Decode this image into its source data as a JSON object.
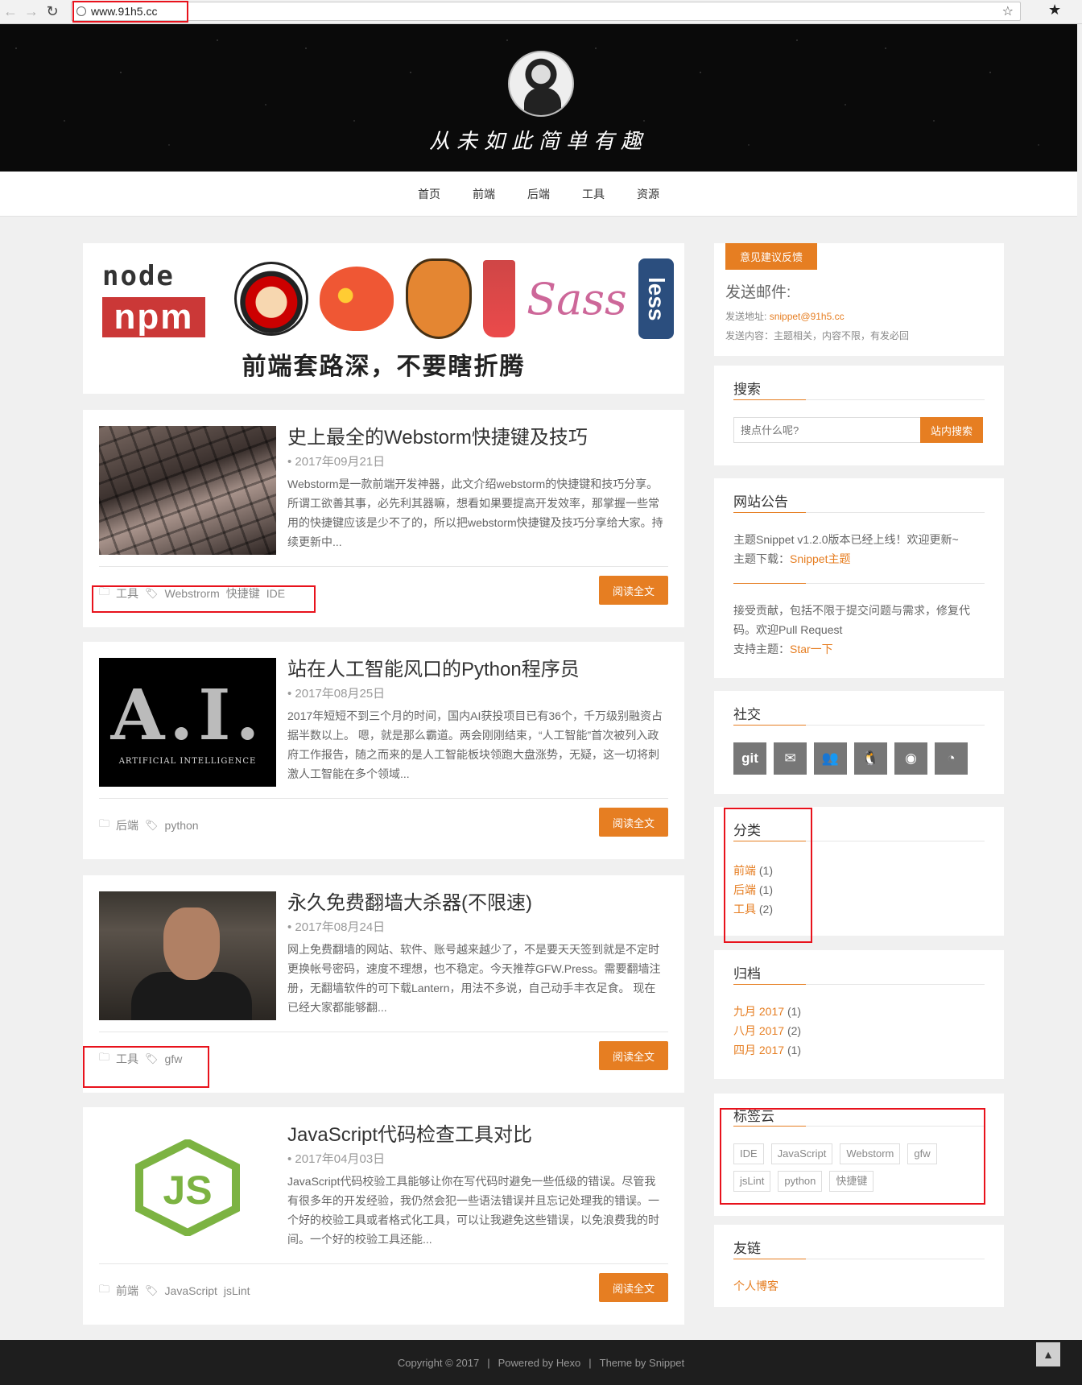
{
  "browser": {
    "url": "www.91h5.cc",
    "back_icon": "←",
    "forward_icon": "→",
    "reload_icon": "↻",
    "star_icon": "☆",
    "ext_icon": "★"
  },
  "header": {
    "tagline": "从未如此简单有趣"
  },
  "nav": [
    "首页",
    "前端",
    "后端",
    "工具",
    "资源"
  ],
  "banner": {
    "node_text": "node",
    "npm_text": "npm",
    "sass_text": "Sass",
    "less_text": "less",
    "gulp_text": "Gulp",
    "slogan": "前端套路深，不要瞎折腾"
  },
  "posts": [
    {
      "title": "史上最全的Webstorm快捷键及技巧",
      "date": "• 2017年09月21日",
      "excerpt": "Webstorm是一款前端开发神器，此文介绍webstorm的快捷键和技巧分享。 所谓工欲善其事，必先利其器嘛，想看如果要提高开发效率，那掌握一些常用的快捷键应该是少不了的，所以把webstorm快捷键及技巧分享给大家。持续更新中...",
      "category": "工具",
      "tags": [
        "Webstrorm",
        "快捷键",
        "IDE"
      ],
      "read_label": "阅读全文"
    },
    {
      "title": "站在人工智能风口的Python程序员",
      "date": "• 2017年08月25日",
      "excerpt": "2017年短短不到三个月的时间，国内AI获投项目已有36个，千万级别融资占据半数以上。 嗯，就是那么霸道。两会刚刚结束，“人工智能”首次被列入政府工作报告，随之而来的是人工智能板块领跑大盘涨势，无疑，这一切将刺激人工智能在多个领域...",
      "category": "后端",
      "tags": [
        "python"
      ],
      "read_label": "阅读全文",
      "thumb_big": "A.I.",
      "thumb_small": "ARTIFICIAL INTELLIGENCE"
    },
    {
      "title": "永久免费翻墙大杀器(不限速)",
      "date": "• 2017年08月24日",
      "excerpt": "网上免费翻墙的网站、软件、账号越来越少了，不是要天天签到就是不定时更换帐号密码，速度不理想，也不稳定。今天推荐GFW.Press。需要翻墙注册，无翻墙软件的可下载Lantern，用法不多说，自己动手丰衣足食。 现在已经大家都能够翻...",
      "category": "工具",
      "tags": [
        "gfw"
      ],
      "read_label": "阅读全文"
    },
    {
      "title": "JavaScript代码检查工具对比",
      "date": "• 2017年04月03日",
      "excerpt": "JavaScript代码校验工具能够让你在写代码时避免一些低级的错误。尽管我有很多年的开发经验，我仍然会犯一些语法错误并且忘记处理我的错误。一个好的校验工具或者格式化工具，可以让我避免这些错误，以免浪费我的时间。一个好的校验工具还能...",
      "category": "前端",
      "tags": [
        "JavaScript",
        "jsLint"
      ],
      "read_label": "阅读全文"
    }
  ],
  "sidebar": {
    "feedback": {
      "tag": "意见建议反馈",
      "heading": "发送邮件:",
      "address_label": "发送地址:",
      "address": "snippet@91h5.cc",
      "content_line": "发送内容：主题相关，内容不限，有发必回"
    },
    "search": {
      "title": "搜索",
      "placeholder": "搜点什么呢?",
      "button": "站内搜索"
    },
    "notice": {
      "title": "网站公告",
      "line1": "主题Snippet v1.2.0版本已经上线！欢迎更新~",
      "line2_label": "主题下载：",
      "line2_link": "Snippet主题",
      "line3": "接受贡献，包括不限于提交问题与需求，修复代",
      "line4": "码。欢迎Pull Request",
      "line5_label": "支持主题：",
      "line5_link": "Star一下"
    },
    "social": {
      "title": "社交",
      "icons": [
        {
          "name": "git-icon",
          "glyph": "git"
        },
        {
          "name": "mail-icon",
          "glyph": "✉"
        },
        {
          "name": "group-icon",
          "glyph": "👥"
        },
        {
          "name": "qq-icon",
          "glyph": "🐧"
        },
        {
          "name": "weibo-icon",
          "glyph": "◉"
        },
        {
          "name": "rss-icon",
          "glyph": "◔"
        }
      ]
    },
    "categories": {
      "title": "分类",
      "items": [
        {
          "label": "前端",
          "count": "(1)"
        },
        {
          "label": "后端",
          "count": "(1)"
        },
        {
          "label": "工具",
          "count": "(2)"
        }
      ]
    },
    "archive": {
      "title": "归档",
      "items": [
        {
          "label": "九月 2017",
          "count": "(1)"
        },
        {
          "label": "八月 2017",
          "count": "(2)"
        },
        {
          "label": "四月 2017",
          "count": "(1)"
        }
      ]
    },
    "tagcloud": {
      "title": "标签云",
      "tags": [
        "IDE",
        "JavaScript",
        "Webstorm",
        "gfw",
        "jsLint",
        "python",
        "快捷键"
      ]
    },
    "links": {
      "title": "友链",
      "items": [
        "个人博客"
      ]
    }
  },
  "footer": {
    "copyright": "Copyright © 2017",
    "powered": "Powered by Hexo",
    "theme": "Theme by Snippet",
    "back_top_icon": "▲"
  },
  "colors": {
    "accent": "#e67e22",
    "highlight": "#e8121c"
  }
}
